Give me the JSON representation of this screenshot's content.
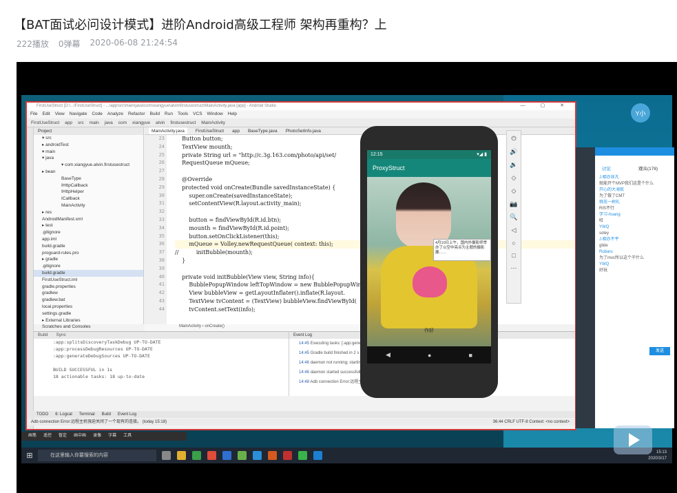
{
  "video": {
    "title": "【BAT面试必问设计模式】进阶Android高级工程师 架构再重构？上",
    "plays": "222播放",
    "danmaku": "0弹幕",
    "date": "2020-06-08 21:24:54"
  },
  "ide": {
    "title_path": "FirstUseStruct [D:\\...\\FirstUseStruct] - ...\\app\\src\\main\\java\\com\\xiangyue\\alvin\\firstusestruct\\MainActivity.java [app] - Android Studio",
    "menu": [
      "File",
      "Edit",
      "View",
      "Navigate",
      "Code",
      "Analyze",
      "Refactor",
      "Build",
      "Run",
      "Tools",
      "VCS",
      "Window",
      "Help"
    ],
    "breadcrumb": [
      "FirstUseStruct",
      "app",
      "src",
      "main",
      "java",
      "com",
      "xiangyue",
      "alvin",
      "firstusestruct",
      "MainActivity"
    ],
    "project_label": "Project",
    "tree": [
      "▾ src",
      "▸ androidTest",
      "▾ main",
      "▾ java",
      "▾ com.xiangyue.alvin.firstusestruct",
      "▸ bean",
      "BaseType",
      "IHttpCallback",
      "IHttpHelper",
      "ICallback",
      "MainActivity",
      "▸ res",
      "AndroidManifest.xml",
      "▸ test",
      ".gitignore",
      "app.iml",
      "build.gradle",
      "proguard-rules.pro",
      "▸ gradle",
      ".gitignore",
      "build.gradle",
      "FirstUseStruct.iml",
      "gradle.properties",
      "gradlew",
      "gradlew.bat",
      "local.properties",
      "settings.gradle",
      "▸ External Libraries",
      "Scratches and Consoles"
    ],
    "tabs": [
      "MainActivity.java",
      "FirstUseStruct",
      "app",
      "BaseType.java",
      "PhotoSetInfo.java"
    ],
    "line_numbers": [
      "23",
      "24",
      "25",
      "26",
      "27",
      "28",
      "29",
      "30",
      "31",
      "32",
      "33",
      "34",
      "35",
      "36",
      "37",
      "38",
      "39",
      "40",
      "41",
      "42",
      "43",
      "44"
    ],
    "code": [
      "    Button button;",
      "    TextView mounth;",
      "    private String url = \"http://c.3g.163.com/photo/api/set/",
      "    RequestQueue mQueue;",
      "",
      "    @Override",
      "    protected void onCreate(Bundle savedInstanceState) {",
      "        super.onCreate(savedInstanceState);",
      "        setContentView(R.layout.activity_main);",
      "",
      "        button = findViewById(R.id.btn);",
      "        mounth = findViewById(R.id.point);",
      "        button.setOnClickListener(this);",
      "        mQueue = Volley.newRequestQueue( context: this);",
      "//          initBubble(mounth);",
      "    }",
      "",
      "    private void initBubble(View view, String info){",
      "        BubblePopupWindow leftTopWindow = new BubblePopupWindow(",
      "        View bubbleView = getLayoutInflater().inflate(R.layout.",
      "        TextView tvContent = (TextView) bubbleView.findViewById(",
      "        tvContent.setText(info);"
    ],
    "editor_breadcrumb": "MainActivity  ›  onCreate()",
    "build_tabs": [
      "Build",
      "Sync"
    ],
    "build_lines": [
      ":app:splitsDiscoveryTaskDebug UP-TO-DATE",
      ":app:processDebugResources UP-TO-DATE",
      ":app:generateDebugSources UP-TO-DATE",
      "",
      "BUILD SUCCESSFUL in 1s",
      "18 actionable tasks: 18 up-to-date"
    ],
    "event_log_label": "Event Log",
    "event_lines": [
      {
        "ts": "14:45",
        "text": "Executing tasks: [:app:gene..."
      },
      {
        "ts": "14:45",
        "text": "Gradle build finished in 2 s"
      },
      {
        "ts": "14:46",
        "text": "daemon not running; starting now at tcp:5037"
      },
      {
        "ts": "14:46",
        "text": "daemon started successfully"
      },
      {
        "ts": "14:48",
        "text": "Adb connection Error:远程主机强迫关闭了一个现有的连接。"
      }
    ],
    "bottom_tabs": [
      "TODO",
      "6: Logcat",
      "Terminal",
      "Build",
      "Event Log"
    ],
    "status_text": "Adb connection Error:远程主机强迫关闭了一个现有的连接。 (today 15:18)",
    "status_right": "36:44  CRLF  UTF-8  Context: <no context>"
  },
  "phone": {
    "time": "12:15",
    "signal": "▾◢ ▮",
    "app_title": "ProxyStruct",
    "bubble_text": "4月10日上午，国内外摄影师举办了以空中亮点为主题的摄影展……",
    "button_label": "作好",
    "nav": [
      "◀",
      "●",
      "■"
    ]
  },
  "emulator_tools": [
    "⏻",
    "🔊",
    "🔉",
    "◇",
    "◇",
    "📷",
    "🔍",
    "◁",
    "○",
    "□",
    "⋯"
  ],
  "chat": {
    "tabs": [
      "讨论",
      "观众(178)"
    ],
    "messages": [
      {
        "name": "J.相亦非凡",
        "text": "就能开个MVP我们这是个什么"
      },
      {
        "name": "开心的大海航",
        "text": "为了做了CMT"
      },
      {
        "name": "桃花一树礼",
        "text": "RIS不行"
      },
      {
        "name": "学习-huang",
        "text": "哈"
      },
      {
        "name": "YWQ",
        "text": "soley"
      },
      {
        "name": "J.相亦不平",
        "text": "glide"
      },
      {
        "name": "Rubaru",
        "text": "为了mvc所以这个干什么"
      },
      {
        "name": "YWQ",
        "text": "好玩"
      }
    ],
    "send_label": "发送"
  },
  "quick_toolbar": [
    "画笔",
    "遥控",
    "暂定",
    "画中画",
    "录像",
    "字幕",
    "工具"
  ],
  "taskbar": {
    "start": "⊞",
    "search_placeholder": "在这里输入你要搜索的内容",
    "tray_time": "15:13",
    "tray_date": "2020/3/17"
  },
  "desktop_avatar": "Y小",
  "colors": {
    "ide_red_border": "#d23a3a",
    "android_teal": "#15877a",
    "chat_blue": "#1e8ee0",
    "taskbar": "#1f2733"
  }
}
